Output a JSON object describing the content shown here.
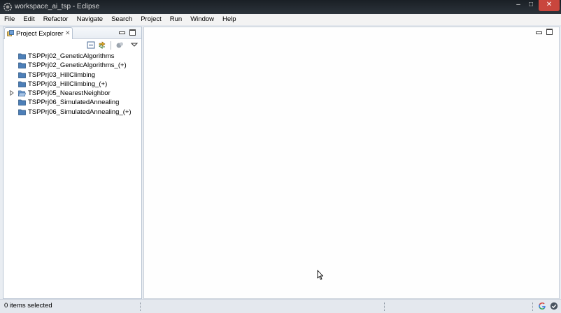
{
  "window": {
    "title": "workspace_ai_tsp - Eclipse",
    "app_icon": "eclipse-icon",
    "controls": {
      "minimize": "–",
      "maximize": "□",
      "close": "✕"
    }
  },
  "menu": [
    "File",
    "Edit",
    "Refactor",
    "Navigate",
    "Search",
    "Project",
    "Run",
    "Window",
    "Help"
  ],
  "project_explorer": {
    "tab_label": "Project Explorer",
    "tab_close": "✕",
    "toolbar_icons": [
      "collapse-all-icon",
      "link-with-editor-icon",
      "focus-icon",
      "view-menu-icon"
    ],
    "projects": [
      {
        "name": "TSPPrj02_GeneticAlgorithms",
        "open": false,
        "expandable": false
      },
      {
        "name": "TSPPrj02_GeneticAlgorithms_(+)",
        "open": false,
        "expandable": false
      },
      {
        "name": "TSPPrj03_HillClimbing",
        "open": false,
        "expandable": false
      },
      {
        "name": "TSPPrj03_HillClimbing_(+)",
        "open": false,
        "expandable": false
      },
      {
        "name": "TSPPrj05_NearestNeighbor",
        "open": true,
        "expandable": true
      },
      {
        "name": "TSPPrj06_SimulatedAnnealing",
        "open": false,
        "expandable": false
      },
      {
        "name": "TSPPrj06_SimulatedAnnealing_(+)",
        "open": false,
        "expandable": false
      }
    ]
  },
  "status_bar": {
    "text": "0 items selected",
    "icons": [
      "google-icon",
      "tasks-check-icon"
    ]
  },
  "colors": {
    "titlebar": "#1f252c",
    "folder": "#4d7fb8",
    "close_button": "#c9463d"
  }
}
